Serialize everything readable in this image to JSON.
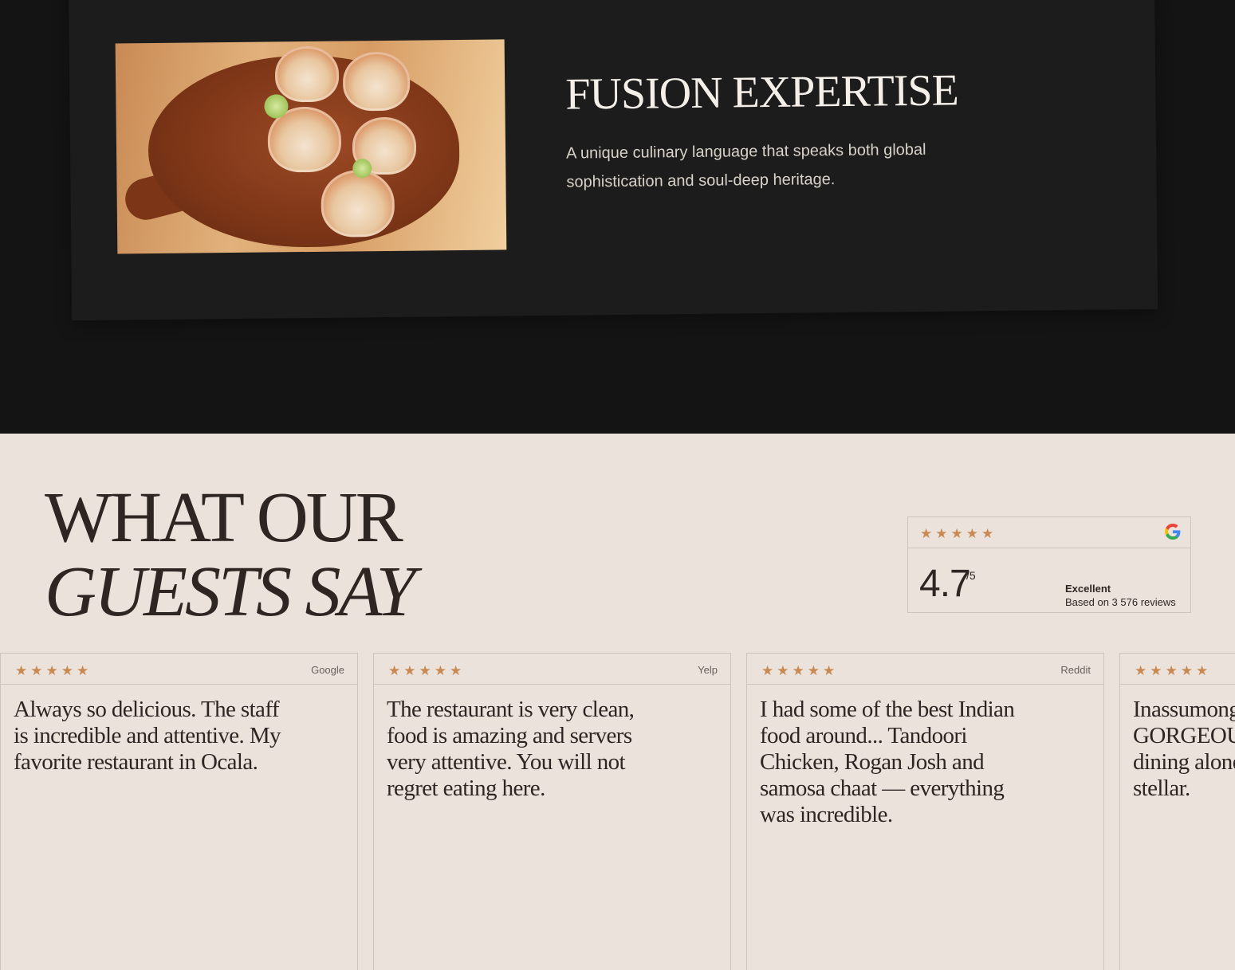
{
  "feature": {
    "title": "FUSION EXPERTISE",
    "description": "A unique culinary language that speaks both global sophistication and soul-deep heritage.",
    "image_alt": "Grilled scallops on a wooden serving board"
  },
  "testimonials": {
    "heading_line1": "WHAT OUR",
    "heading_line2": "GUESTS SAY",
    "summary": {
      "stars": "★★★★★",
      "value": "4.7",
      "max": "/5",
      "label": "Excellent",
      "count": "Based on 3 576 reviews",
      "source_icon": "google-icon"
    },
    "reviews": [
      {
        "stars": "★★★★★",
        "source": "Google",
        "text": "Always so delicious. The staff is incredible and attentive. My favorite restaurant in Ocala."
      },
      {
        "stars": "★★★★★",
        "source": "Yelp",
        "text": "The restaurant is very clean, food is amazing and servers very attentive. You will not regret eating here."
      },
      {
        "stars": "★★★★★",
        "source": "Reddit",
        "text": "I had some of the best Indian food around... Tandoori Chicken, Rogan Josh and samosa chaat — everything was incredible."
      },
      {
        "stars": "★★★★★",
        "source": "",
        "text": "Inassumong GORGEOUS dining alone stellar."
      }
    ]
  },
  "colors": {
    "dark_bg": "#141414",
    "card_bg": "#1c1c1c",
    "light_bg": "#ebe2dc",
    "star": "#c98a52",
    "text_dark": "#2e2623"
  }
}
